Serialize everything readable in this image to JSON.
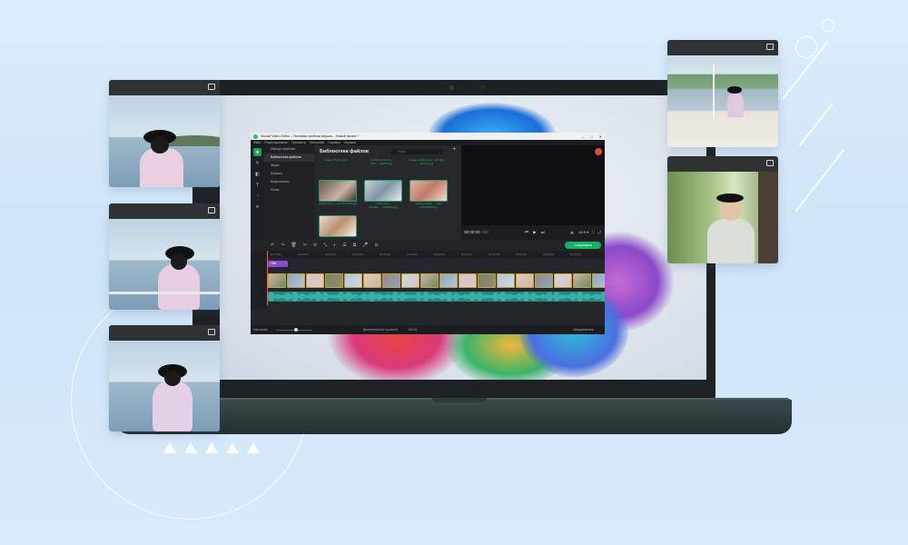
{
  "app": {
    "window_title": "Movavi Video Editor – Тестовая пробная версия – Новый проект *",
    "window_controls": [
      "–",
      "□",
      "✕"
    ],
    "menu": [
      "Файл",
      "Редактирование",
      "Просмотр",
      "Настройки",
      "Справка",
      "Справка"
    ],
    "tools": [
      {
        "icon": "import-icon",
        "glyph": "⊕",
        "active": true
      },
      {
        "icon": "wand-icon",
        "glyph": "✎",
        "active": false
      },
      {
        "icon": "transitions-icon",
        "glyph": "◧",
        "active": false
      },
      {
        "icon": "titles-icon",
        "glyph": "T",
        "active": false
      },
      {
        "icon": "stickers-icon",
        "glyph": "◔",
        "active": false
      },
      {
        "icon": "more-tools-icon",
        "glyph": "✕",
        "active": false
      }
    ],
    "nav": [
      {
        "label": "Импорт файлов",
        "active": false
      },
      {
        "label": "Библиотека файлов",
        "active": true
      },
      {
        "label": "Звуки",
        "active": false
      },
      {
        "label": "Музыка",
        "active": false
      },
      {
        "label": "Видеоклипы",
        "active": false
      },
      {
        "label": "Фоны",
        "active": false
      }
    ],
    "library": {
      "title": "Библиотека файлов",
      "search_placeholder": "Поиск",
      "add": "+",
      "top_captions": [
        "ocean_Towns.mp3",
        "wedding-party-in-pink-…-00075.jpg",
        "elegant-adults-gow-…22-u6g-airrove.jpg"
      ],
      "items": [
        {
          "caption": "portrait-of-a-…-cd_d6a4b5c.jpg"
        },
        {
          "caption": "pretty-teen-woman-…-7011893.jpg"
        },
        {
          "caption": "smiling-adults-…-woll-3OHP8WB.jpg"
        },
        {
          "caption": ""
        }
      ]
    },
    "preview": {
      "timecode": "00:00:00",
      "timecode_frames": "000",
      "play_controls": [
        "⏮",
        "▶",
        "⏭"
      ],
      "right_controls": [
        "🔈",
        "16:9 ▾",
        "⛶",
        "⤢"
      ]
    },
    "edit_tools": [
      "↶",
      "↷",
      "🗑",
      "✂",
      "⟳",
      "⤡",
      "◐",
      "☰",
      "⧉",
      "🎤",
      "⊙"
    ],
    "save_label": "Сохранить",
    "ruler": [
      "00:00:00",
      "00:00:05",
      "00:00:10",
      "00:00:15",
      "00:00:20",
      "00:00:25",
      "00:00:30",
      "00:00:35",
      "00:00:40",
      "00:00:45",
      "00:00:50",
      "00:00:55"
    ],
    "title_clip": "Title",
    "video_clip_count": 20,
    "audio_clip_label": "ocean_Towns.mp3",
    "status": {
      "zoom_label": "Масштаб",
      "duration_label": "Длительность проекта:",
      "duration_value": "00:34",
      "notifications": "Уведомления"
    }
  },
  "colors": {
    "accent_green": "#19b067",
    "app_dark": "#24262b",
    "title_clip": "#8a4bd1",
    "audio_track": "#1e8a83",
    "clip_border": "#c9a227"
  }
}
